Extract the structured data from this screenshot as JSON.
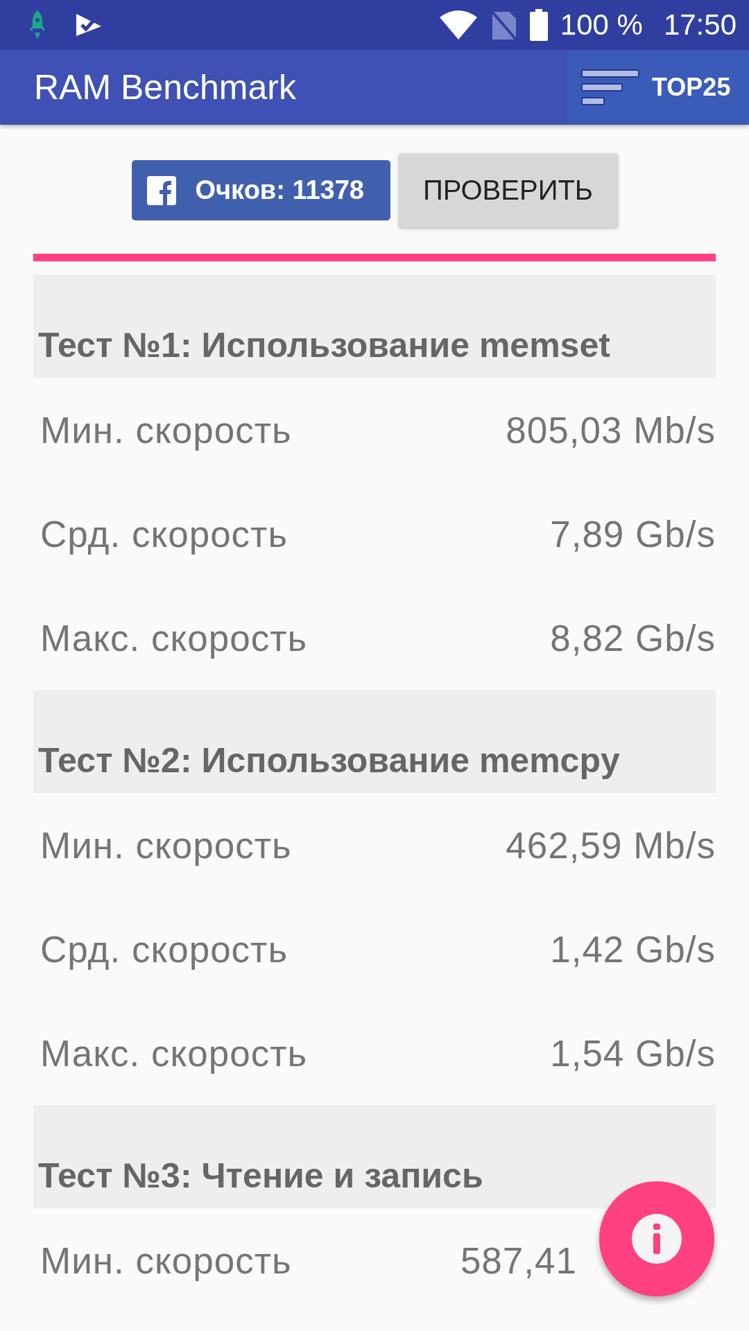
{
  "status_bar": {
    "battery": "100 %",
    "time": "17:50"
  },
  "app_bar": {
    "title": "RAM Benchmark",
    "action": "TOP25"
  },
  "score_button": "Очков: 11378",
  "check_button": "ПРОВЕРИТЬ",
  "sections": [
    {
      "title": "Тест №1: Использование memset",
      "rows": [
        {
          "label": "Мин. скорость",
          "value": "805,03 Mb/s"
        },
        {
          "label": "Срд. скорость",
          "value": "7,89 Gb/s"
        },
        {
          "label": "Макс. скорость",
          "value": "8,82 Gb/s"
        }
      ]
    },
    {
      "title": "Тест №2: Использование memcpy",
      "rows": [
        {
          "label": "Мин. скорость",
          "value": "462,59 Mb/s"
        },
        {
          "label": "Срд. скорость",
          "value": "1,42 Gb/s"
        },
        {
          "label": "Макс. скорость",
          "value": "1,54 Gb/s"
        }
      ]
    },
    {
      "title": "Тест №3: Чтение и запись",
      "rows": [
        {
          "label": "Мин. скорость",
          "value": "587,41"
        }
      ]
    }
  ]
}
